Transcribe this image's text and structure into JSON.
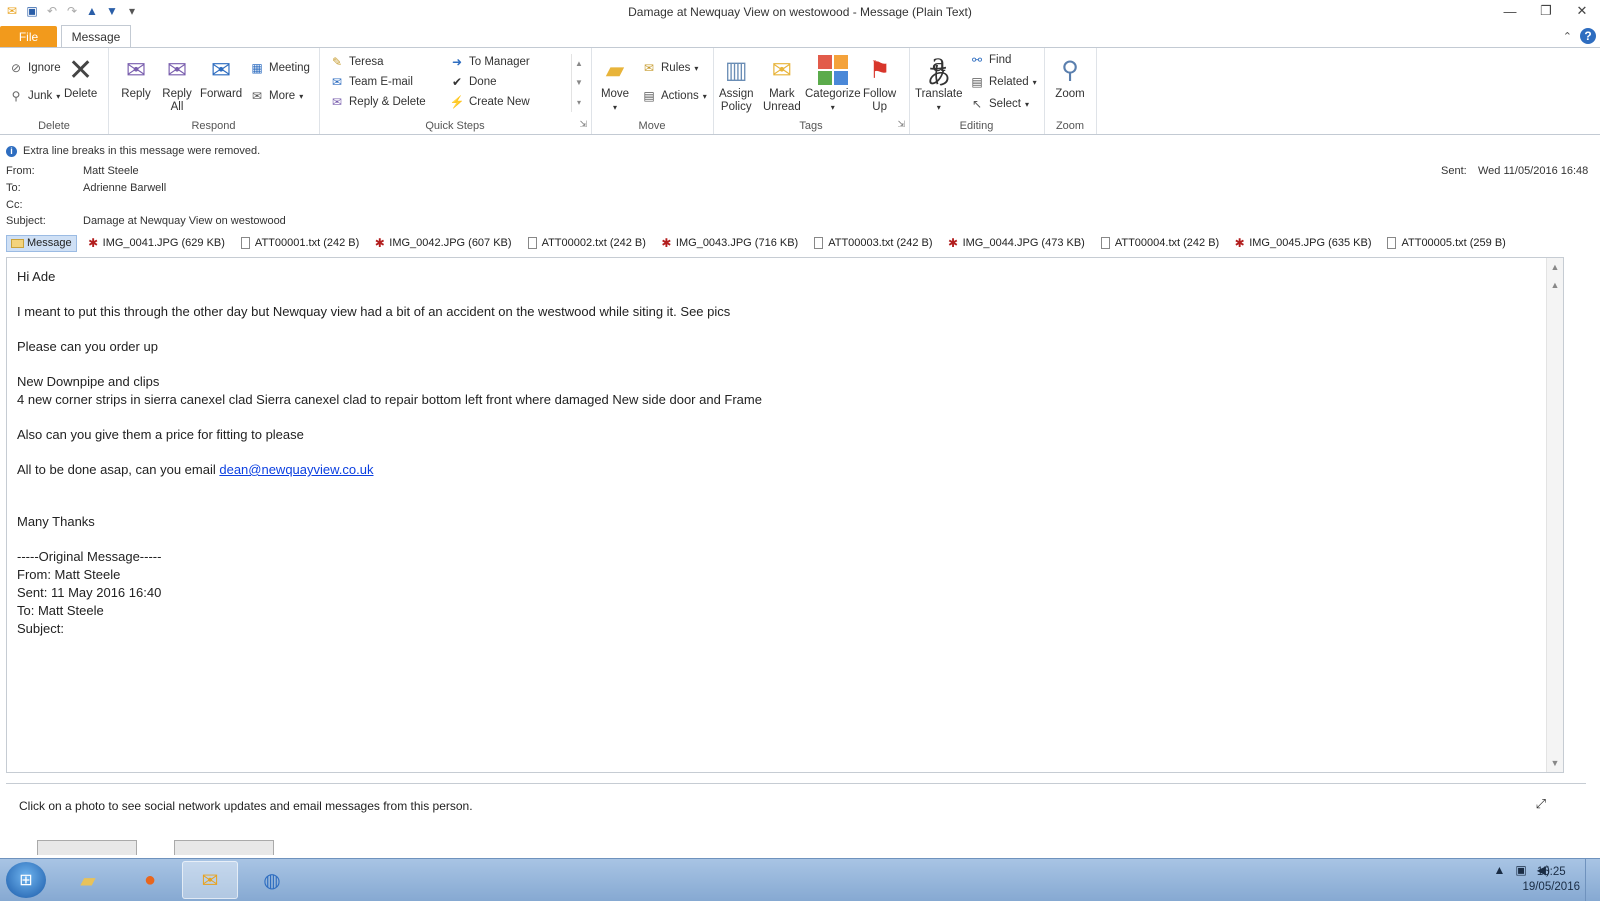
{
  "window": {
    "title": "Damage at Newquay View on westowood  -  Message (Plain Text)"
  },
  "tabs": {
    "file": "File",
    "message": "Message"
  },
  "ribbon": {
    "delete_group": {
      "label": "Delete",
      "ignore": "Ignore",
      "junk": "Junk",
      "delete": "Delete"
    },
    "respond_group": {
      "label": "Respond",
      "reply": "Reply",
      "reply_all_1": "Reply",
      "reply_all_2": "All",
      "forward": "Forward",
      "meeting": "Meeting",
      "more": "More"
    },
    "quicksteps_group": {
      "label": "Quick Steps",
      "items": [
        "Teresa",
        "To Manager",
        "Team E-mail",
        "Done",
        "Reply & Delete",
        "Create New"
      ]
    },
    "move_group": {
      "label": "Move",
      "move": "Move",
      "rules": "Rules",
      "actions": "Actions"
    },
    "tags_group": {
      "label": "Tags",
      "assign_1": "Assign",
      "assign_2": "Policy",
      "mark_1": "Mark",
      "mark_2": "Unread",
      "categorize": "Categorize",
      "follow_1": "Follow",
      "follow_2": "Up"
    },
    "editing_group": {
      "label": "Editing",
      "translate": "Translate",
      "find": "Find",
      "related": "Related",
      "select": "Select"
    },
    "zoom_group": {
      "label": "Zoom",
      "zoom": "Zoom"
    }
  },
  "message": {
    "info": "Extra line breaks in this message were removed.",
    "from_label": "From:",
    "from": "Matt Steele",
    "to_label": "To:",
    "to": "Adrienne Barwell",
    "cc_label": "Cc:",
    "subject_label": "Subject:",
    "subject": "Damage at Newquay View on westowood",
    "sent_label": "Sent:",
    "sent": "Wed 11/05/2016 16:48",
    "attachments": [
      {
        "name": "Message",
        "type": "message"
      },
      {
        "name": "IMG_0041.JPG (629 KB)",
        "type": "jpg"
      },
      {
        "name": "ATT00001.txt (242 B)",
        "type": "txt"
      },
      {
        "name": "IMG_0042.JPG (607 KB)",
        "type": "jpg"
      },
      {
        "name": "ATT00002.txt (242 B)",
        "type": "txt"
      },
      {
        "name": "IMG_0043.JPG (716 KB)",
        "type": "jpg"
      },
      {
        "name": "ATT00003.txt (242 B)",
        "type": "txt"
      },
      {
        "name": "IMG_0044.JPG (473 KB)",
        "type": "jpg"
      },
      {
        "name": "ATT00004.txt (242 B)",
        "type": "txt"
      },
      {
        "name": "IMG_0045.JPG (635 KB)",
        "type": "jpg"
      },
      {
        "name": "ATT00005.txt (259 B)",
        "type": "txt"
      }
    ],
    "body": {
      "greeting": "Hi Ade",
      "line1": "I meant to put this through the other day but Newquay view had a bit of an accident on the westwood while siting it. See pics",
      "line2": "Please can you order up",
      "line3": "New Downpipe and clips",
      "line4": "4 new corner strips in sierra canexel clad Sierra canexel clad to repair bottom left front where damaged New side door and Frame",
      "line5": "Also can you give them a price for fitting to please",
      "line6_prefix": "All to be done asap, can you email ",
      "line6_link": "dean@newquayview.co.uk",
      "signoff": "Many Thanks",
      "orig_header": "-----Original Message-----",
      "orig_from": "From: Matt Steele",
      "orig_sent": "Sent: 11 May 2016 16:40",
      "orig_to": "To: Matt Steele",
      "orig_subject": "Subject:"
    }
  },
  "people_pane": {
    "text": "Click on a photo to see social network updates and email messages from this person."
  },
  "taskbar": {
    "time": "15:25",
    "date": "19/05/2016"
  }
}
